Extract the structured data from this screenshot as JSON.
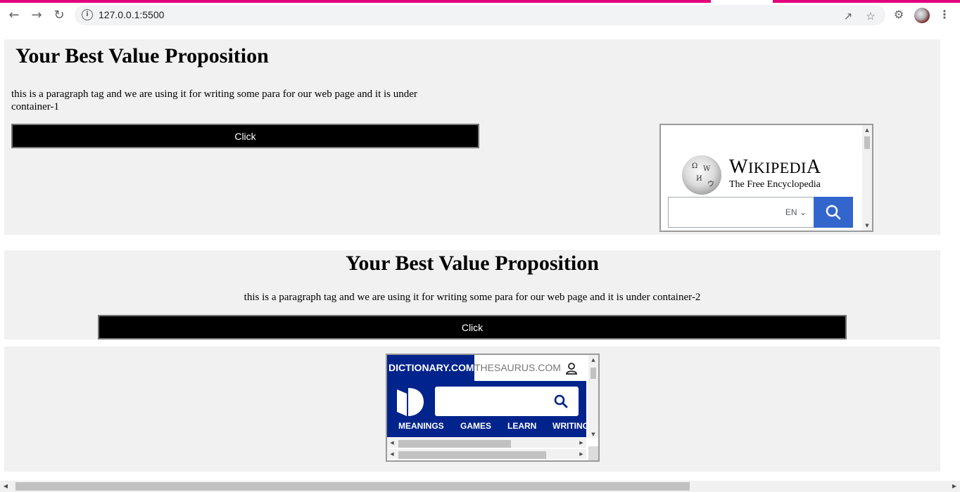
{
  "browser": {
    "url": "127.0.0.1:5500",
    "accent_color": "#e3007c",
    "icons": [
      "back-icon",
      "forward-icon",
      "reload-icon",
      "info-icon",
      "share-icon",
      "star-icon",
      "extensions-icon",
      "menu-icon"
    ]
  },
  "container1": {
    "heading": "Your Best Value Proposition",
    "paragraph_line1": "this is a paragraph tag and we are using it for writing some para for our web page and it is under",
    "paragraph_line2": "container-1",
    "button_label": "Click"
  },
  "container2": {
    "heading": "Your Best Value Proposition",
    "paragraph": "this is a paragraph tag and we are using it for writing some para for our web page and it is under container-2",
    "button_label": "Click"
  },
  "wikipedia_frame": {
    "title": "Wikipedia",
    "subtitle": "The Free Encyclopedia",
    "language": "EN",
    "accent_color": "#3366cc"
  },
  "dictionary_frame": {
    "tab_active": "DICTIONARY.COM",
    "tab_inactive": "THESAURUS.COM",
    "nav": [
      "MEANINGS",
      "GAMES",
      "LEARN",
      "WRITING"
    ],
    "brand_color": "#00248b"
  }
}
